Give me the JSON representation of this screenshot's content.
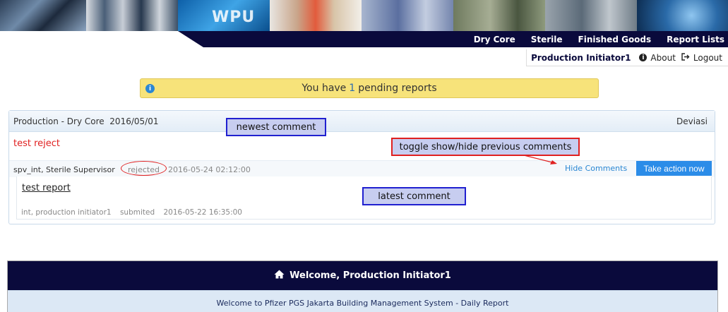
{
  "banner": {
    "wpu_text": "WPU"
  },
  "nav": {
    "items": [
      "Dry Core",
      "Sterile",
      "Finished Goods",
      "Report Lists"
    ]
  },
  "user": {
    "name": "Production Initiator1",
    "about_label": "About",
    "logout_label": "Logout"
  },
  "alert": {
    "prefix": "You have",
    "count": "1",
    "suffix": "pending reports"
  },
  "report": {
    "header_title": "Production - Dry Core  2016/05/01",
    "header_type": "Deviasi",
    "latest_comment_text": "test reject",
    "latest_author": "spv_int, Sterile Supervisor",
    "latest_status": "rejected",
    "latest_date": "2016-05-24 02:12:00",
    "hide_comments_label": "Hide Comments",
    "take_action_label": "Take action now",
    "previous_title": "test report",
    "previous_author": "int, production initiator1",
    "previous_status": "submited",
    "previous_date": "2016-05-22 16:35:00"
  },
  "annotations": {
    "newest": "newest comment",
    "toggle": "toggle show/hide previous comments",
    "latest": "latest comment"
  },
  "welcome": {
    "title": "Welcome, Production Initiator1",
    "body": "Welcome to Pfizer PGS Jakarta Building Management System - Daily Report"
  },
  "icons": {
    "info": "info-icon",
    "about": "info-circle-icon",
    "logout": "sign-out-icon",
    "home": "home-icon"
  },
  "colors": {
    "navy": "#0a0a3c",
    "alert_bg": "#f7e37a",
    "action_blue": "#2b8ce8",
    "reject_red": "#e02020"
  }
}
